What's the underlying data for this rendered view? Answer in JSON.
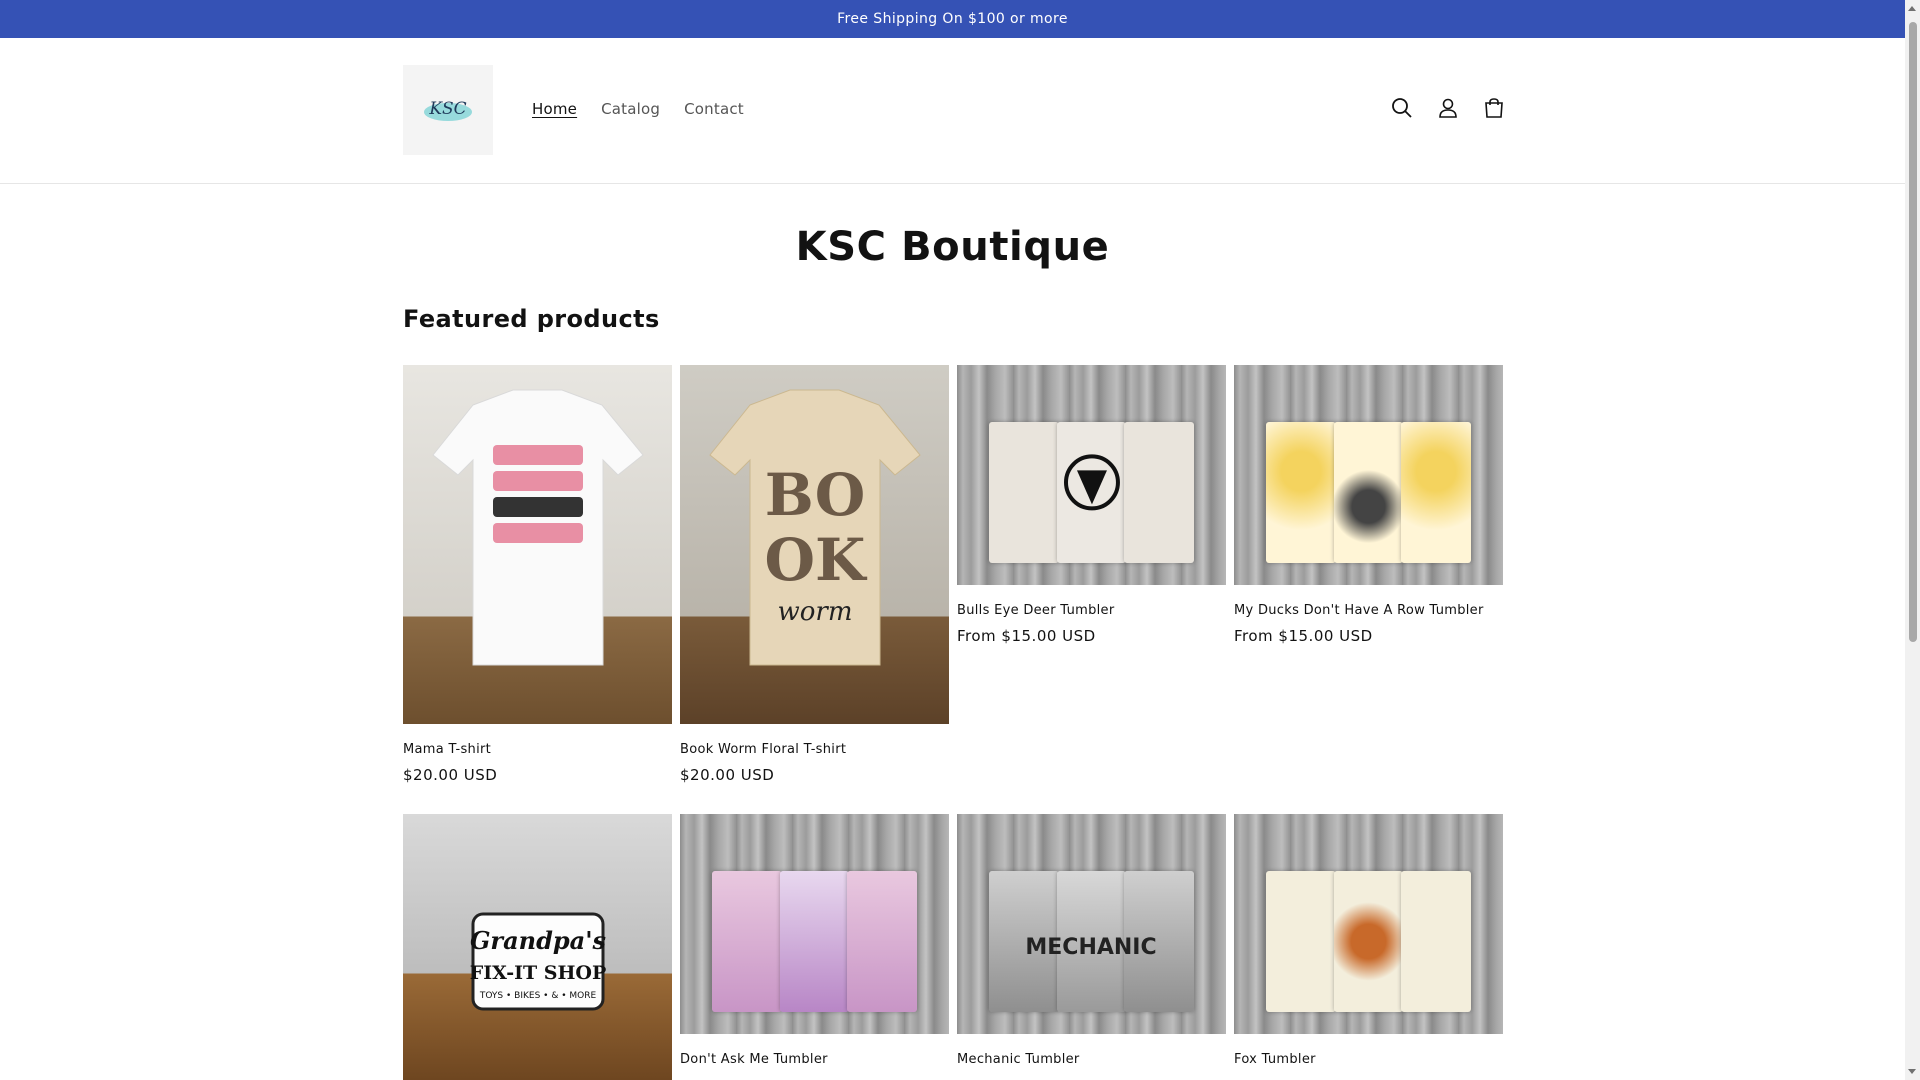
{
  "announcement": {
    "text": "Free Shipping On $100 or more"
  },
  "header": {
    "logo_text": "KSC",
    "nav": [
      {
        "label": "Home",
        "active": true
      },
      {
        "label": "Catalog",
        "active": false
      },
      {
        "label": "Contact",
        "active": false
      }
    ],
    "icons": [
      "search-icon",
      "account-icon",
      "cart-icon"
    ]
  },
  "page": {
    "title": "KSC Boutique",
    "section_title": "Featured products"
  },
  "products": [
    {
      "name": "Mama T-shirt",
      "price": "$20.00 USD",
      "image": "white-tshirt"
    },
    {
      "name": "Book Worm Floral T-shirt",
      "price": "$20.00 USD",
      "image": "tan-tshirt"
    },
    {
      "name": "Bulls Eye Deer Tumbler",
      "price": "From $15.00 USD",
      "image": "deer-tumbler"
    },
    {
      "name": "My Ducks Don't Have A Row Tumbler",
      "price": "From $15.00 USD",
      "image": "ducks-tumbler"
    },
    {
      "name": "",
      "price": "",
      "image": "grandpa-sign",
      "art_line1": "Grandpa's",
      "art_line2": "FIX-IT SHOP",
      "art_line3": "TOYS • BIKES • & • MORE"
    },
    {
      "name": "Don't Ask Me Tumbler",
      "price": "",
      "image": "floral-tumbler"
    },
    {
      "name": "Mechanic Tumbler",
      "price": "",
      "image": "mechanic-tumbler",
      "art_text": "MECHANIC"
    },
    {
      "name": "Fox Tumbler",
      "price": "",
      "image": "fox-tumbler"
    }
  ],
  "colors": {
    "announcement_bg": "#3552b5",
    "text": "#121212"
  }
}
